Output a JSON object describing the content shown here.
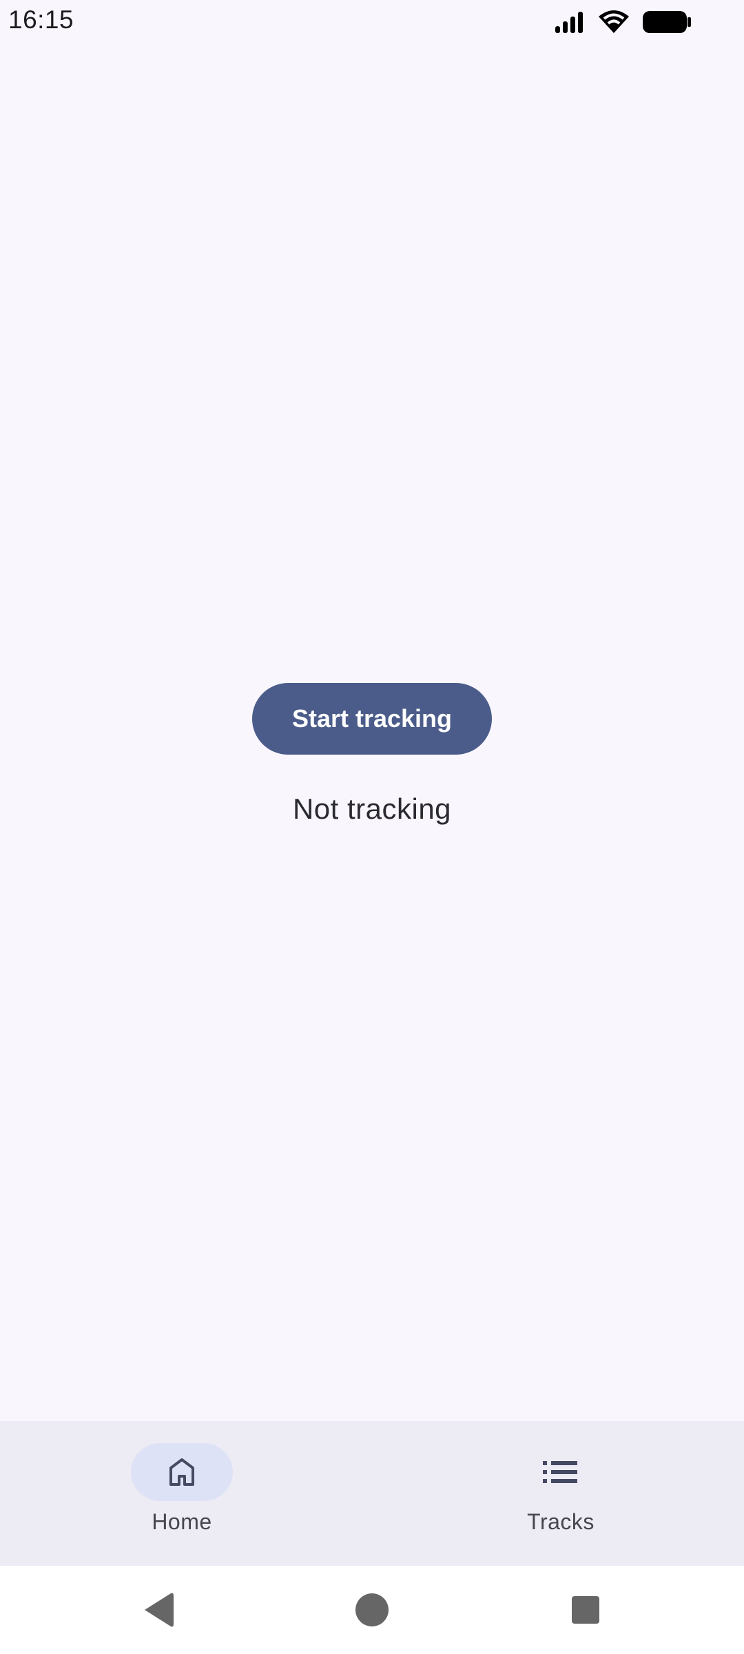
{
  "status_bar": {
    "time": "16:15",
    "icons": [
      "signal-icon",
      "wifi-icon",
      "battery-icon"
    ]
  },
  "main": {
    "start_button_label": "Start tracking",
    "tracking_status": "Not tracking"
  },
  "bottom_nav": {
    "items": [
      {
        "label": "Home",
        "icon": "home-icon",
        "selected": true
      },
      {
        "label": "Tracks",
        "icon": "list-icon",
        "selected": false
      }
    ]
  },
  "system_nav": {
    "buttons": [
      "back-icon",
      "home-circle-icon",
      "recents-icon"
    ]
  },
  "colors": {
    "background": "#F9F7FD",
    "primary": "#4B5C8A",
    "nav_background": "#EDEBF4",
    "nav_indicator": "#DEE2F7",
    "on_surface_variant": "#45464F"
  }
}
